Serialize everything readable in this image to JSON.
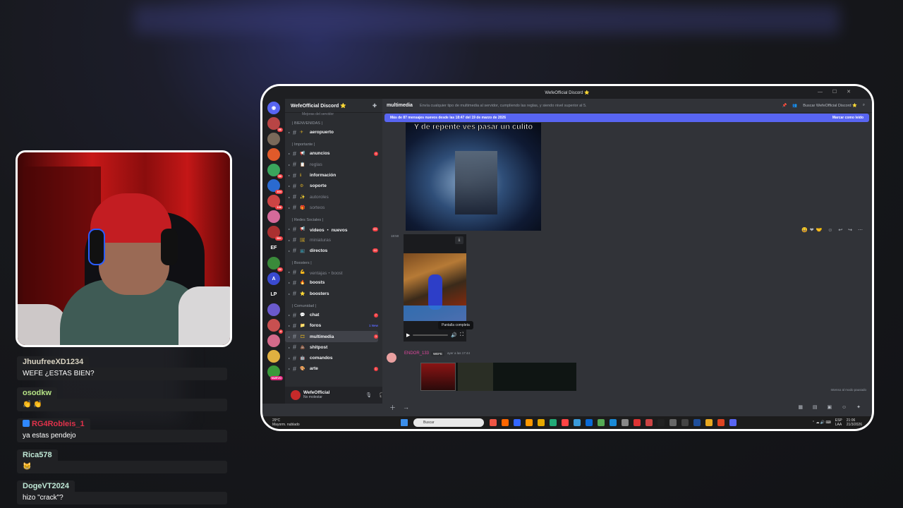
{
  "chat": [
    {
      "user": "JhuufreeXD1234",
      "color": "#d9d3c2",
      "text": "WEFE ¿ESTAS BIEN?",
      "badge": false
    },
    {
      "user": "osodkw",
      "color": "#b6e486",
      "text": "👏 👏",
      "badge": false
    },
    {
      "user": "RG4Robleis_1",
      "color": "#e0324b",
      "text": "ya estas pendejo",
      "badge": true
    },
    {
      "user": "Rica578",
      "color": "#bfe8d6",
      "text": "😸",
      "badge": false
    },
    {
      "user": "DogeVT2024",
      "color": "#bfe8d6",
      "text": "hizo \"crack\"?",
      "badge": false
    }
  ],
  "window": {
    "title": "WefeOfficial Discord ⭐"
  },
  "servers": [
    {
      "color": "#b84545",
      "count": "46"
    },
    {
      "color": "#7a6a5a",
      "count": ""
    },
    {
      "color": "#e05a2a",
      "count": ""
    },
    {
      "color": "#3aa55c",
      "count": "50"
    },
    {
      "color": "#2a6ad0",
      "count": "164"
    },
    {
      "color": "#c44",
      "count": "136"
    },
    {
      "color": "#d46a9a",
      "count": ""
    },
    {
      "color": "#aa3030",
      "count": "99+"
    },
    {
      "color": "#1e1f22",
      "label": "EF",
      "count": ""
    },
    {
      "color": "#3a8a3a",
      "count": "32"
    },
    {
      "color": "#3a4ad0",
      "label": "A",
      "count": ""
    },
    {
      "color": "#1e1f22",
      "label": "LP",
      "count": ""
    },
    {
      "color": "#6a5acd",
      "count": ""
    },
    {
      "color": "#c85050",
      "count": "4"
    },
    {
      "color": "#d46a8a",
      "count": ""
    },
    {
      "color": "#e0b040",
      "count": ""
    },
    {
      "color": "#3a9a3a",
      "count": "NUEVO"
    }
  ],
  "server": {
    "name": "WefeOfficial Discord ⭐",
    "subtitle": "Mejoras del servidor",
    "categories": [
      {
        "name": "| BIENVENIDAS |",
        "channels": [
          {
            "emo": "✈",
            "name": "aeropuerto",
            "muted": false,
            "badge": ""
          }
        ]
      },
      {
        "name": "| Importante |",
        "channels": [
          {
            "emo": "📢",
            "name": "anuncios",
            "muted": false,
            "badge": "4"
          },
          {
            "emo": "📋",
            "name": "reglas",
            "muted": true,
            "badge": ""
          },
          {
            "emo": "ℹ",
            "name": "información",
            "muted": false,
            "badge": ""
          },
          {
            "emo": "⚙",
            "name": "soporte",
            "muted": false,
            "badge": ""
          },
          {
            "emo": "✨",
            "name": "autoroles",
            "muted": true,
            "badge": ""
          },
          {
            "emo": "🎁",
            "name": "sorteos",
            "muted": true,
            "badge": ""
          }
        ]
      },
      {
        "name": "| Redes Sociales |",
        "channels": [
          {
            "emo": "📢",
            "name": "videos ・ nuevos",
            "muted": false,
            "badge": "63"
          },
          {
            "emo": "🖼",
            "name": "miniaturas",
            "muted": true,
            "badge": ""
          },
          {
            "emo": "📺",
            "name": "directos",
            "muted": false,
            "badge": "44"
          }
        ]
      },
      {
        "name": "| Boosters |",
        "channels": [
          {
            "emo": "💪",
            "name": "ventajas・boost",
            "muted": true,
            "badge": ""
          },
          {
            "emo": "🔥",
            "name": "boosts",
            "muted": false,
            "badge": ""
          },
          {
            "emo": "⭐",
            "name": "boosters",
            "muted": false,
            "badge": ""
          }
        ]
      },
      {
        "name": "| Comunidad |",
        "channels": [
          {
            "emo": "💬",
            "name": "chat",
            "muted": false,
            "badge": "7"
          },
          {
            "emo": "📁",
            "name": "foros",
            "muted": false,
            "badge": "",
            "new": "1 New"
          },
          {
            "emo": "🎞",
            "name": "multimedia",
            "muted": false,
            "badge": "3",
            "active": true
          },
          {
            "emo": "💩",
            "name": "shitpost",
            "muted": false,
            "badge": ""
          },
          {
            "emo": "🤖",
            "name": "comandos",
            "muted": false,
            "badge": ""
          },
          {
            "emo": "🎨",
            "name": "arte",
            "muted": false,
            "badge": "1"
          }
        ]
      }
    ]
  },
  "user": {
    "name": "WefeOfficial",
    "status": "No molestar"
  },
  "channel": {
    "title": "multimedia",
    "topic": "Envía cualquier tipo de multimedia al servidor, cumpliendo las reglas, y siendo nivel superior al 5.",
    "search": "Buscar WefeOfficial Discord ⭐"
  },
  "new_messages": {
    "text": "Más de 87 mensajes nuevos desde las 18:47 del 19 de marzo de 2026",
    "action": "Marcar como leído"
  },
  "messages": {
    "gif_caption": "Y de repente ves pasar un culito",
    "time1": "18:50",
    "tooltip": "Pantalla completa",
    "author": "ENDOR_133",
    "author_tag": "WEFE",
    "author_time": "ayer a las 17:44",
    "muted_note": "Intenso al modo pausado"
  },
  "taskbar": {
    "temp": "29°C",
    "weather": "Mayorm. nublado",
    "search": "Buscar",
    "lang": "ESP\nLAA",
    "time": "21:06\n21/3/2026"
  }
}
